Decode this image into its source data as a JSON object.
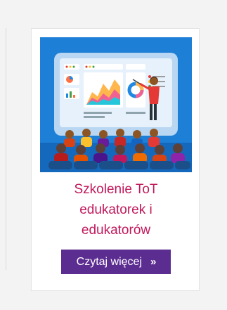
{
  "card": {
    "title_lines": [
      "Szkolenie ToT",
      "edukatorek i",
      "edukatorów"
    ],
    "button_label": "Czytaj więcej",
    "button_icon": "double-chevron-right-icon",
    "image_icon": "presentation-classroom-illustration",
    "colors": {
      "title": "#c2185b",
      "button_bg": "#5c2d91",
      "illustration_bg": "#1e7fd6"
    }
  }
}
